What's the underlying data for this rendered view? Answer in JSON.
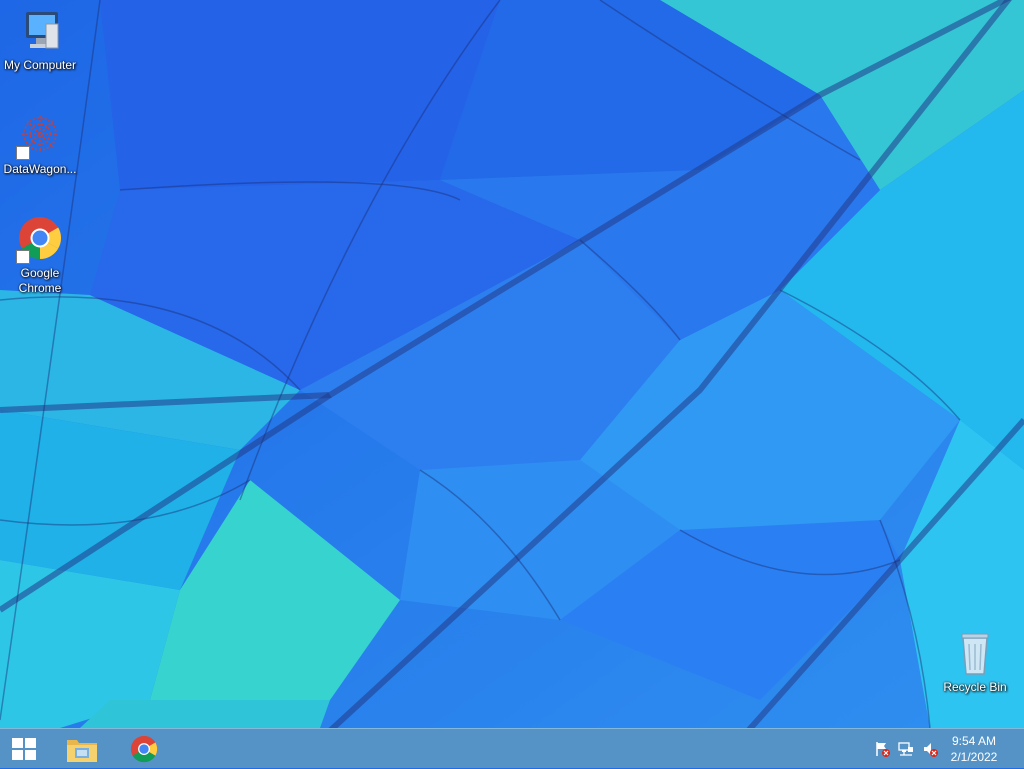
{
  "desktop": {
    "icons": [
      {
        "label": "My Computer",
        "icon": "computer-icon"
      },
      {
        "label": "DataWagon...",
        "icon": "datawagon-icon"
      },
      {
        "label": "Google Chrome",
        "icon": "chrome-icon"
      },
      {
        "label": "Recycle Bin",
        "icon": "recycle-bin-icon"
      }
    ]
  },
  "taskbar": {
    "start_icon": "windows-start-icon",
    "pinned": [
      {
        "icon": "file-explorer-icon"
      },
      {
        "icon": "chrome-icon"
      }
    ],
    "tray": [
      {
        "icon": "action-center-flag-icon"
      },
      {
        "icon": "network-icon"
      },
      {
        "icon": "volume-muted-icon"
      }
    ],
    "clock": {
      "time": "9:54 AM",
      "date": "2/1/2022"
    }
  }
}
